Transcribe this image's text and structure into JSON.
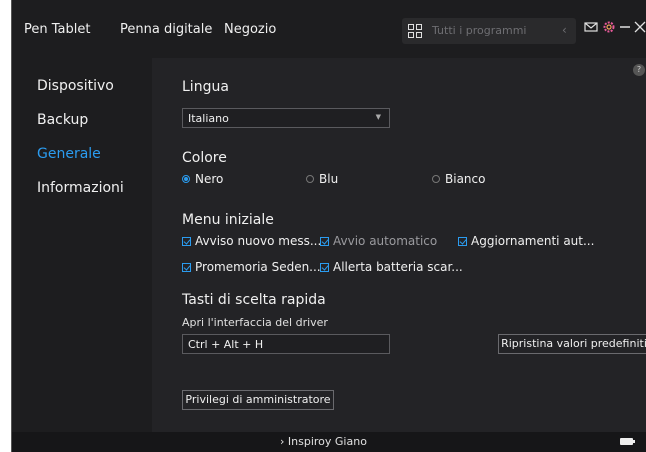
{
  "topbar": {
    "menu": [
      "Pen Tablet",
      "Penna digitale",
      "Negozio"
    ],
    "search_placeholder": "Tutti i programmi",
    "search_chevron": "‹"
  },
  "sidebar": {
    "items": [
      {
        "label": "Dispositivo",
        "active": false
      },
      {
        "label": "Backup",
        "active": false
      },
      {
        "label": "Generale",
        "active": true
      },
      {
        "label": "Informazioni",
        "active": false
      }
    ]
  },
  "main": {
    "help": "?",
    "language": {
      "title": "Lingua",
      "value": "Italiano"
    },
    "color": {
      "title": "Colore",
      "options": [
        {
          "label": "Nero",
          "selected": true
        },
        {
          "label": "Blu",
          "selected": false
        },
        {
          "label": "Bianco",
          "selected": false
        }
      ]
    },
    "startup": {
      "title": "Menu iniziale",
      "items": [
        {
          "label": "Avviso nuovo mess...",
          "checked": true,
          "dimmed": false
        },
        {
          "label": "Avvio automatico",
          "checked": true,
          "dimmed": true
        },
        {
          "label": "Aggiornamenti aut...",
          "checked": true,
          "dimmed": false
        },
        {
          "label": "Promemoria Seden...",
          "checked": true,
          "dimmed": false
        },
        {
          "label": "Allerta batteria scar...",
          "checked": true,
          "dimmed": false
        }
      ]
    },
    "shortcuts": {
      "title": "Tasti di scelta rapida",
      "subtitle": "Apri l'interfaccia del driver",
      "value": "Ctrl + Alt + H",
      "reset_label": "Ripristina valori predefiniti"
    },
    "admin_label": "Privilegi di amministratore"
  },
  "bottombar": {
    "device": "› Inspiroy Giano"
  },
  "colors": {
    "accent": "#2b9cf0",
    "background": "#1d1d1f",
    "panel": "#232326"
  }
}
